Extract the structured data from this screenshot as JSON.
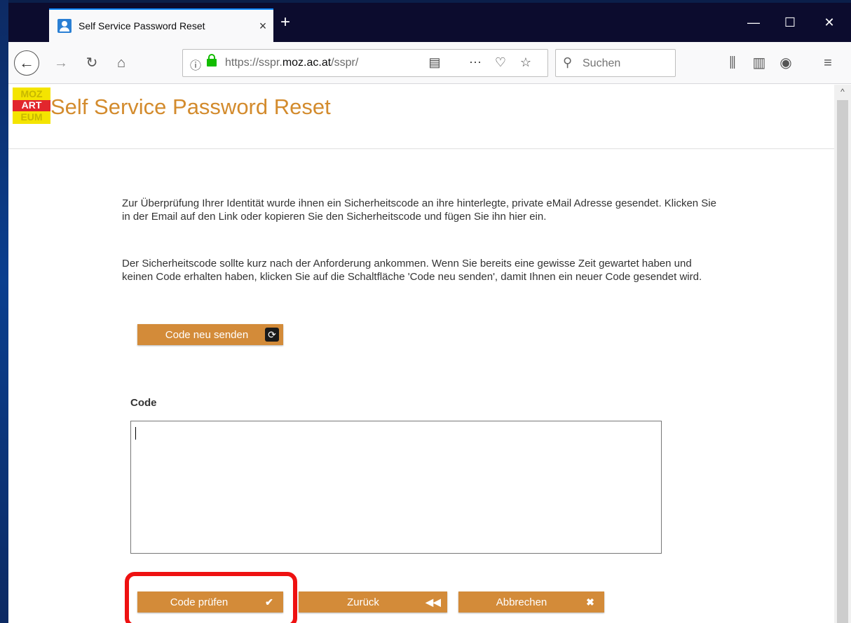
{
  "browser": {
    "tab_title": "Self Service Password Reset",
    "tab_close": "×",
    "new_tab": "+",
    "window_controls": {
      "minimize": "—",
      "maximize": "☐",
      "close": "✕"
    },
    "url_info": "ⓘ",
    "url_scheme": "https://sspr.",
    "url_host": "moz.ac.at",
    "url_path": "/sspr/",
    "search_placeholder": "Suchen",
    "nav_icons": [
      "arrow-back-icon",
      "arrow-forward-icon",
      "reload-icon",
      "home-icon",
      "reader-view-icon",
      "page-actions-icon",
      "pocket-icon",
      "bookmark-star-icon",
      "library-icon",
      "sidebar-icon",
      "account-icon",
      "menu-icon"
    ]
  },
  "header": {
    "logo_lines": [
      "MOZ",
      "ART",
      "EUM"
    ],
    "title": "Self Service Password Reset"
  },
  "body": {
    "paragraph1": "Zur Überprüfung Ihrer Identität wurde ihnen ein Sicherheitscode an ihre hinterlegte, private eMail Adresse gesendet. Klicken Sie in der Email auf den Link oder kopieren Sie den Sicherheitscode und fügen Sie ihn hier ein.",
    "paragraph2": "Der Sicherheitscode sollte kurz nach der Anforderung ankommen. Wenn Sie bereits eine gewisse Zeit gewartet haben und keinen Code erhalten haben, klicken Sie auf die Schaltfläche 'Code neu senden', damit Ihnen ein neuer Code gesendet wird.",
    "resend_button": "Code neu senden",
    "code_label": "Code",
    "code_value": ""
  },
  "actions": {
    "check_button": "Code prüfen",
    "back_button": "Zurück",
    "cancel_button": "Abbrechen"
  },
  "colors": {
    "accent": "#d38b39",
    "title": "#d38b2d",
    "highlight": "#ee1111"
  }
}
